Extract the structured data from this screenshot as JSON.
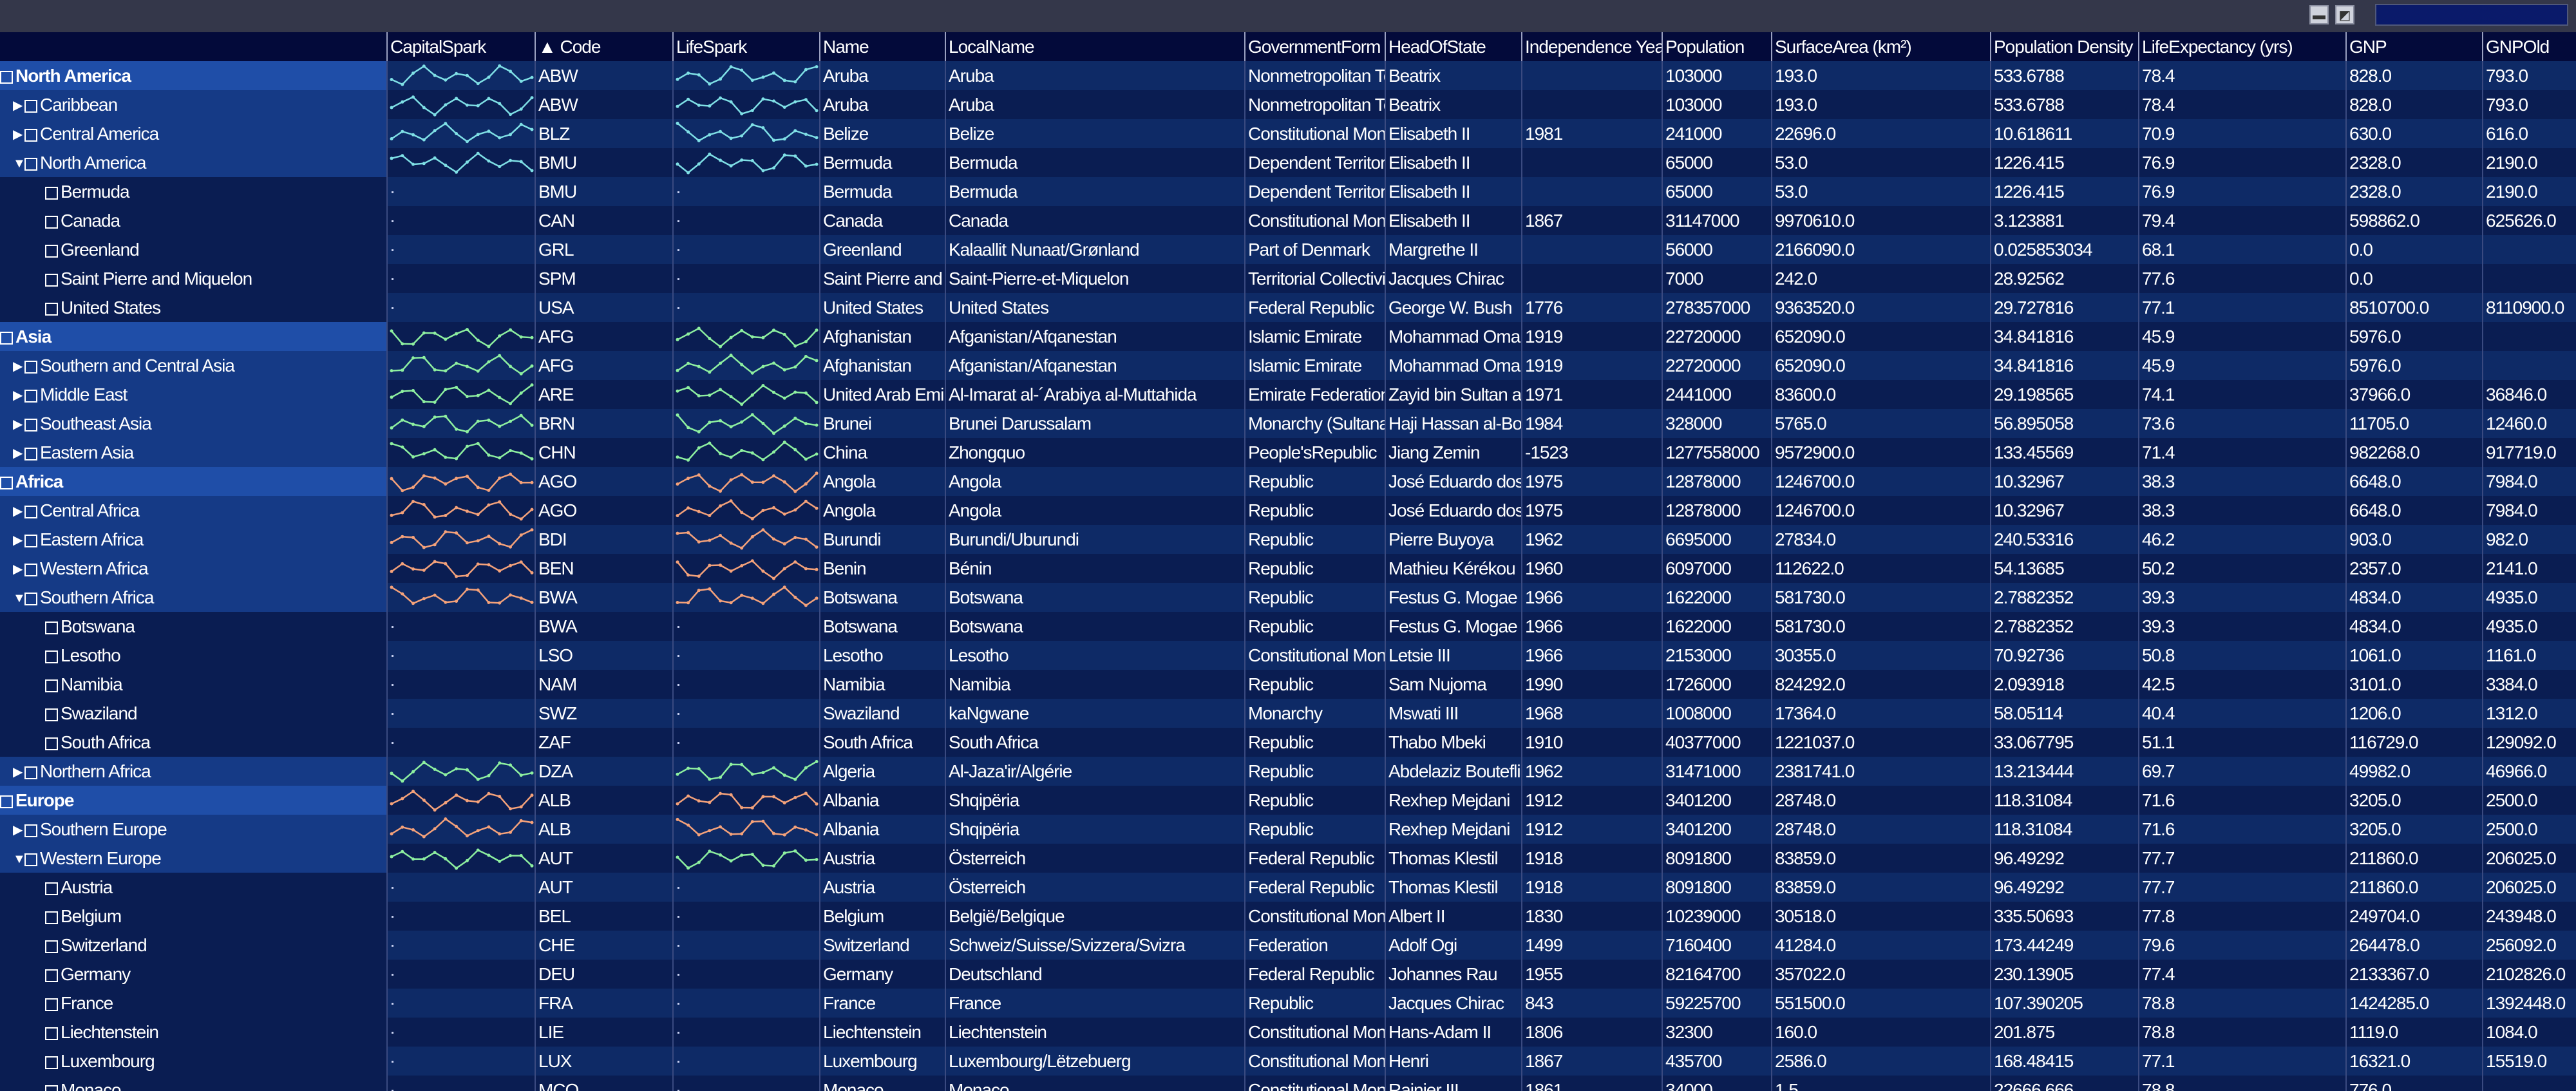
{
  "topbar": {
    "btn1_glyph": "▬",
    "btn2_glyph": "◩"
  },
  "columns": [
    {
      "key": "capital_spark",
      "label": "CapitalSpark"
    },
    {
      "key": "code",
      "label": "▲ Code"
    },
    {
      "key": "life_spark",
      "label": "LifeSpark"
    },
    {
      "key": "name",
      "label": "Name"
    },
    {
      "key": "local",
      "label": "LocalName"
    },
    {
      "key": "gov",
      "label": "GovernmentForm"
    },
    {
      "key": "head",
      "label": "HeadOfState"
    },
    {
      "key": "indep",
      "label": "Independence Year"
    },
    {
      "key": "pop",
      "label": "Population"
    },
    {
      "key": "area",
      "label": "SurfaceArea (km²)"
    },
    {
      "key": "dens",
      "label": "Population Density"
    },
    {
      "key": "life",
      "label": "LifeExpectancy (yrs)"
    },
    {
      "key": "gnp",
      "label": "GNP"
    },
    {
      "key": "gnpold",
      "label": "GNPOld"
    }
  ],
  "rows": [
    {
      "tree": "North America",
      "level": "group",
      "exp": "□",
      "spark": "cyan",
      "code": "ABW",
      "name": "Aruba",
      "local": "Aruba",
      "gov": "Nonmetropolitan Territory",
      "head": "Beatrix",
      "indep": "",
      "pop": "103000",
      "area": "193.0",
      "dens": "533.6788",
      "life": "78.4",
      "gnp": "828.0",
      "gnpold": "793.0"
    },
    {
      "tree": "Caribbean",
      "level": "sub",
      "exp": "▶",
      "spark": "cyan",
      "code": "ABW",
      "name": "Aruba",
      "local": "Aruba",
      "gov": "Nonmetropolitan Territory",
      "head": "Beatrix",
      "indep": "",
      "pop": "103000",
      "area": "193.0",
      "dens": "533.6788",
      "life": "78.4",
      "gnp": "828.0",
      "gnpold": "793.0"
    },
    {
      "tree": "Central America",
      "level": "sub",
      "exp": "▶",
      "spark": "cyan",
      "code": "BLZ",
      "name": "Belize",
      "local": "Belize",
      "gov": "Constitutional Monarchy",
      "head": "Elisabeth II",
      "indep": "1981",
      "pop": "241000",
      "area": "22696.0",
      "dens": "10.618611",
      "life": "70.9",
      "gnp": "630.0",
      "gnpold": "616.0"
    },
    {
      "tree": "North America",
      "level": "sub",
      "exp": "▼",
      "spark": "cyan",
      "code": "BMU",
      "name": "Bermuda",
      "local": "Bermuda",
      "gov": "Dependent Territory",
      "head": "Elisabeth II",
      "indep": "",
      "pop": "65000",
      "area": "53.0",
      "dens": "1226.415",
      "life": "76.9",
      "gnp": "2328.0",
      "gnpold": "2190.0"
    },
    {
      "tree": "Bermuda",
      "level": "leaf",
      "exp": "",
      "spark": "",
      "code": "BMU",
      "name": "Bermuda",
      "local": "Bermuda",
      "gov": "Dependent Territory",
      "head": "Elisabeth II",
      "indep": "",
      "pop": "65000",
      "area": "53.0",
      "dens": "1226.415",
      "life": "76.9",
      "gnp": "2328.0",
      "gnpold": "2190.0"
    },
    {
      "tree": "Canada",
      "level": "leaf",
      "exp": "",
      "spark": "",
      "code": "CAN",
      "name": "Canada",
      "local": "Canada",
      "gov": "Constitutional Monarchy",
      "head": "Elisabeth II",
      "indep": "1867",
      "pop": "31147000",
      "area": "9970610.0",
      "dens": "3.123881",
      "life": "79.4",
      "gnp": "598862.0",
      "gnpold": "625626.0"
    },
    {
      "tree": "Greenland",
      "level": "leaf",
      "exp": "",
      "spark": "",
      "code": "GRL",
      "name": "Greenland",
      "local": "Kalaallit Nunaat/Grønland",
      "gov": "Part of Denmark",
      "head": "Margrethe II",
      "indep": "",
      "pop": "56000",
      "area": "2166090.0",
      "dens": "0.025853034",
      "life": "68.1",
      "gnp": "0.0",
      "gnpold": ""
    },
    {
      "tree": "Saint Pierre and Miquelon",
      "level": "leaf",
      "exp": "",
      "spark": "",
      "code": "SPM",
      "name": "Saint Pierre and Miquelon",
      "local": "Saint-Pierre-et-Miquelon",
      "gov": "Territorial Collectivity",
      "head": "Jacques Chirac",
      "indep": "",
      "pop": "7000",
      "area": "242.0",
      "dens": "28.92562",
      "life": "77.6",
      "gnp": "0.0",
      "gnpold": ""
    },
    {
      "tree": "United States",
      "level": "leaf",
      "exp": "",
      "spark": "",
      "code": "USA",
      "name": "United States",
      "local": "United States",
      "gov": "Federal Republic",
      "head": "George W. Bush",
      "indep": "1776",
      "pop": "278357000",
      "area": "9363520.0",
      "dens": "29.727816",
      "life": "77.1",
      "gnp": "8510700.0",
      "gnpold": "8110900.0"
    },
    {
      "tree": "Asia",
      "level": "group",
      "exp": "□",
      "spark": "green",
      "code": "AFG",
      "name": "Afghanistan",
      "local": "Afganistan/Afqanestan",
      "gov": "Islamic Emirate",
      "head": "Mohammad Omar",
      "indep": "1919",
      "pop": "22720000",
      "area": "652090.0",
      "dens": "34.841816",
      "life": "45.9",
      "gnp": "5976.0",
      "gnpold": ""
    },
    {
      "tree": "Southern and Central Asia",
      "level": "sub",
      "exp": "▶",
      "spark": "green",
      "code": "AFG",
      "name": "Afghanistan",
      "local": "Afganistan/Afqanestan",
      "gov": "Islamic Emirate",
      "head": "Mohammad Omar",
      "indep": "1919",
      "pop": "22720000",
      "area": "652090.0",
      "dens": "34.841816",
      "life": "45.9",
      "gnp": "5976.0",
      "gnpold": ""
    },
    {
      "tree": "Middle East",
      "level": "sub",
      "exp": "▶",
      "spark": "green",
      "code": "ARE",
      "name": "United Arab Emirates",
      "local": "Al-Imarat al-´Arabiya al-Muttahida",
      "gov": "Emirate Federation",
      "head": "Zayid bin Sultan al-Nahayan",
      "indep": "1971",
      "pop": "2441000",
      "area": "83600.0",
      "dens": "29.198565",
      "life": "74.1",
      "gnp": "37966.0",
      "gnpold": "36846.0"
    },
    {
      "tree": "Southeast Asia",
      "level": "sub",
      "exp": "▶",
      "spark": "green",
      "code": "BRN",
      "name": "Brunei",
      "local": "Brunei Darussalam",
      "gov": "Monarchy (Sultanate)",
      "head": "Haji Hassan al-Bolkiah",
      "indep": "1984",
      "pop": "328000",
      "area": "5765.0",
      "dens": "56.895058",
      "life": "73.6",
      "gnp": "11705.0",
      "gnpold": "12460.0"
    },
    {
      "tree": "Eastern Asia",
      "level": "sub",
      "exp": "▶",
      "spark": "green",
      "code": "CHN",
      "name": "China",
      "local": "Zhongquo",
      "gov": "People'sRepublic",
      "head": "Jiang Zemin",
      "indep": "-1523",
      "pop": "1277558000",
      "area": "9572900.0",
      "dens": "133.45569",
      "life": "71.4",
      "gnp": "982268.0",
      "gnpold": "917719.0"
    },
    {
      "tree": "Africa",
      "level": "group",
      "exp": "□",
      "spark": "orange",
      "code": "AGO",
      "name": "Angola",
      "local": "Angola",
      "gov": "Republic",
      "head": "José Eduardo dos Santos",
      "indep": "1975",
      "pop": "12878000",
      "area": "1246700.0",
      "dens": "10.32967",
      "life": "38.3",
      "gnp": "6648.0",
      "gnpold": "7984.0"
    },
    {
      "tree": "Central Africa",
      "level": "sub",
      "exp": "▶",
      "spark": "orange",
      "code": "AGO",
      "name": "Angola",
      "local": "Angola",
      "gov": "Republic",
      "head": "José Eduardo dos Santos",
      "indep": "1975",
      "pop": "12878000",
      "area": "1246700.0",
      "dens": "10.32967",
      "life": "38.3",
      "gnp": "6648.0",
      "gnpold": "7984.0"
    },
    {
      "tree": "Eastern Africa",
      "level": "sub",
      "exp": "▶",
      "spark": "orange",
      "code": "BDI",
      "name": "Burundi",
      "local": "Burundi/Uburundi",
      "gov": "Republic",
      "head": "Pierre Buyoya",
      "indep": "1962",
      "pop": "6695000",
      "area": "27834.0",
      "dens": "240.53316",
      "life": "46.2",
      "gnp": "903.0",
      "gnpold": "982.0"
    },
    {
      "tree": "Western Africa",
      "level": "sub",
      "exp": "▶",
      "spark": "orange",
      "code": "BEN",
      "name": "Benin",
      "local": "Bénin",
      "gov": "Republic",
      "head": "Mathieu Kérékou",
      "indep": "1960",
      "pop": "6097000",
      "area": "112622.0",
      "dens": "54.13685",
      "life": "50.2",
      "gnp": "2357.0",
      "gnpold": "2141.0"
    },
    {
      "tree": "Southern Africa",
      "level": "sub",
      "exp": "▼",
      "spark": "orange",
      "code": "BWA",
      "name": "Botswana",
      "local": "Botswana",
      "gov": "Republic",
      "head": "Festus G. Mogae",
      "indep": "1966",
      "pop": "1622000",
      "area": "581730.0",
      "dens": "2.7882352",
      "life": "39.3",
      "gnp": "4834.0",
      "gnpold": "4935.0"
    },
    {
      "tree": "Botswana",
      "level": "leaf",
      "exp": "",
      "spark": "",
      "code": "BWA",
      "name": "Botswana",
      "local": "Botswana",
      "gov": "Republic",
      "head": "Festus G. Mogae",
      "indep": "1966",
      "pop": "1622000",
      "area": "581730.0",
      "dens": "2.7882352",
      "life": "39.3",
      "gnp": "4834.0",
      "gnpold": "4935.0"
    },
    {
      "tree": "Lesotho",
      "level": "leaf",
      "exp": "",
      "spark": "",
      "code": "LSO",
      "name": "Lesotho",
      "local": "Lesotho",
      "gov": "Constitutional Monarchy",
      "head": "Letsie III",
      "indep": "1966",
      "pop": "2153000",
      "area": "30355.0",
      "dens": "70.92736",
      "life": "50.8",
      "gnp": "1061.0",
      "gnpold": "1161.0"
    },
    {
      "tree": "Namibia",
      "level": "leaf",
      "exp": "",
      "spark": "",
      "code": "NAM",
      "name": "Namibia",
      "local": "Namibia",
      "gov": "Republic",
      "head": "Sam Nujoma",
      "indep": "1990",
      "pop": "1726000",
      "area": "824292.0",
      "dens": "2.093918",
      "life": "42.5",
      "gnp": "3101.0",
      "gnpold": "3384.0"
    },
    {
      "tree": "Swaziland",
      "level": "leaf",
      "exp": "",
      "spark": "",
      "code": "SWZ",
      "name": "Swaziland",
      "local": "kaNgwane",
      "gov": "Monarchy",
      "head": "Mswati III",
      "indep": "1968",
      "pop": "1008000",
      "area": "17364.0",
      "dens": "58.05114",
      "life": "40.4",
      "gnp": "1206.0",
      "gnpold": "1312.0"
    },
    {
      "tree": "South Africa",
      "level": "leaf",
      "exp": "",
      "spark": "",
      "code": "ZAF",
      "name": "South Africa",
      "local": "South Africa",
      "gov": "Republic",
      "head": "Thabo Mbeki",
      "indep": "1910",
      "pop": "40377000",
      "area": "1221037.0",
      "dens": "33.067795",
      "life": "51.1",
      "gnp": "116729.0",
      "gnpold": "129092.0"
    },
    {
      "tree": "Northern Africa",
      "level": "sub",
      "exp": "▶",
      "spark": "green",
      "code": "DZA",
      "name": "Algeria",
      "local": "Al-Jaza'ir/Algérie",
      "gov": "Republic",
      "head": "Abdelaziz Bouteflika",
      "indep": "1962",
      "pop": "31471000",
      "area": "2381741.0",
      "dens": "13.213444",
      "life": "69.7",
      "gnp": "49982.0",
      "gnpold": "46966.0"
    },
    {
      "tree": "Europe",
      "level": "group",
      "exp": "□",
      "spark": "orange",
      "code": "ALB",
      "name": "Albania",
      "local": "Shqipëria",
      "gov": "Republic",
      "head": "Rexhep Mejdani",
      "indep": "1912",
      "pop": "3401200",
      "area": "28748.0",
      "dens": "118.31084",
      "life": "71.6",
      "gnp": "3205.0",
      "gnpold": "2500.0"
    },
    {
      "tree": "Southern Europe",
      "level": "sub",
      "exp": "▶",
      "spark": "orange",
      "code": "ALB",
      "name": "Albania",
      "local": "Shqipëria",
      "gov": "Republic",
      "head": "Rexhep Mejdani",
      "indep": "1912",
      "pop": "3401200",
      "area": "28748.0",
      "dens": "118.31084",
      "life": "71.6",
      "gnp": "3205.0",
      "gnpold": "2500.0"
    },
    {
      "tree": "Western Europe",
      "level": "sub",
      "exp": "▼",
      "spark": "green",
      "code": "AUT",
      "name": "Austria",
      "local": "Österreich",
      "gov": "Federal Republic",
      "head": "Thomas Klestil",
      "indep": "1918",
      "pop": "8091800",
      "area": "83859.0",
      "dens": "96.49292",
      "life": "77.7",
      "gnp": "211860.0",
      "gnpold": "206025.0"
    },
    {
      "tree": "Austria",
      "level": "leaf",
      "exp": "",
      "spark": "",
      "code": "AUT",
      "name": "Austria",
      "local": "Österreich",
      "gov": "Federal Republic",
      "head": "Thomas Klestil",
      "indep": "1918",
      "pop": "8091800",
      "area": "83859.0",
      "dens": "96.49292",
      "life": "77.7",
      "gnp": "211860.0",
      "gnpold": "206025.0"
    },
    {
      "tree": "Belgium",
      "level": "leaf",
      "exp": "",
      "spark": "",
      "code": "BEL",
      "name": "Belgium",
      "local": "België/Belgique",
      "gov": "Constitutional Monarchy, Federation",
      "head": "Albert II",
      "indep": "1830",
      "pop": "10239000",
      "area": "30518.0",
      "dens": "335.50693",
      "life": "77.8",
      "gnp": "249704.0",
      "gnpold": "243948.0"
    },
    {
      "tree": "Switzerland",
      "level": "leaf",
      "exp": "",
      "spark": "",
      "code": "CHE",
      "name": "Switzerland",
      "local": "Schweiz/Suisse/Svizzera/Svizra",
      "gov": "Federation",
      "head": "Adolf Ogi",
      "indep": "1499",
      "pop": "7160400",
      "area": "41284.0",
      "dens": "173.44249",
      "life": "79.6",
      "gnp": "264478.0",
      "gnpold": "256092.0"
    },
    {
      "tree": "Germany",
      "level": "leaf",
      "exp": "",
      "spark": "",
      "code": "DEU",
      "name": "Germany",
      "local": "Deutschland",
      "gov": "Federal Republic",
      "head": "Johannes Rau",
      "indep": "1955",
      "pop": "82164700",
      "area": "357022.0",
      "dens": "230.13905",
      "life": "77.4",
      "gnp": "2133367.0",
      "gnpold": "2102826.0"
    },
    {
      "tree": "France",
      "level": "leaf",
      "exp": "",
      "spark": "",
      "code": "FRA",
      "name": "France",
      "local": "France",
      "gov": "Republic",
      "head": "Jacques Chirac",
      "indep": "843",
      "pop": "59225700",
      "area": "551500.0",
      "dens": "107.390205",
      "life": "78.8",
      "gnp": "1424285.0",
      "gnpold": "1392448.0"
    },
    {
      "tree": "Liechtenstein",
      "level": "leaf",
      "exp": "",
      "spark": "",
      "code": "LIE",
      "name": "Liechtenstein",
      "local": "Liechtenstein",
      "gov": "Constitutional Monarchy",
      "head": "Hans-Adam II",
      "indep": "1806",
      "pop": "32300",
      "area": "160.0",
      "dens": "201.875",
      "life": "78.8",
      "gnp": "1119.0",
      "gnpold": "1084.0"
    },
    {
      "tree": "Luxembourg",
      "level": "leaf",
      "exp": "",
      "spark": "",
      "code": "LUX",
      "name": "Luxembourg",
      "local": "Luxembourg/Lëtzebuerg",
      "gov": "Constitutional Monarchy",
      "head": "Henri",
      "indep": "1867",
      "pop": "435700",
      "area": "2586.0",
      "dens": "168.48415",
      "life": "77.1",
      "gnp": "16321.0",
      "gnpold": "15519.0"
    },
    {
      "tree": "Monaco",
      "level": "leaf",
      "exp": "",
      "spark": "",
      "code": "MCO",
      "name": "Monaco",
      "local": "Monaco",
      "gov": "Constitutional Monarchy",
      "head": "Rainier III",
      "indep": "1861",
      "pop": "34000",
      "area": "1.5",
      "dens": "22666.666",
      "life": "78.8",
      "gnp": "776.0",
      "gnpold": ""
    }
  ]
}
